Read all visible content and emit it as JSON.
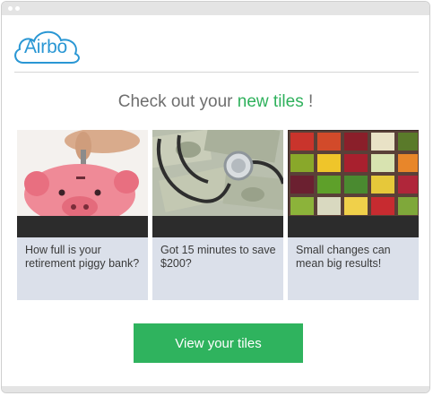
{
  "brand": {
    "logo_text": "Airbo",
    "accent": "#2a97d4"
  },
  "headline": {
    "prefix": "Check out your ",
    "highlight": "new tiles",
    "suffix": " !",
    "highlight_color": "#2fb15c"
  },
  "tiles": [
    {
      "caption": "How full is your retirement piggy bank?",
      "image": "piggy-bank-image"
    },
    {
      "caption": "Got 15 minutes to save $200?",
      "image": "stethoscope-money-image"
    },
    {
      "caption": "Small changes can mean big results!",
      "image": "produce-grid-image"
    }
  ],
  "cta": {
    "label": "View your tiles",
    "color": "#2fb35e"
  }
}
